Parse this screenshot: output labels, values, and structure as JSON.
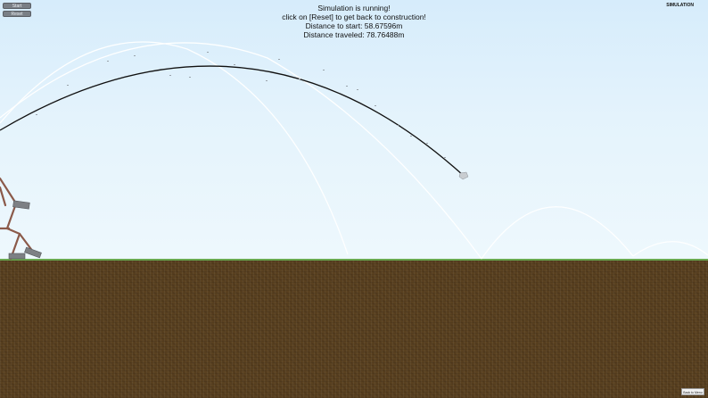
{
  "toolbar": {
    "start_label": "Start",
    "reset_label": "Reset"
  },
  "status": {
    "line1": "Simulation is running!",
    "line2": "click on [Reset] to get back to construction!",
    "line3": "Distance to start: 58.67596m",
    "line4": "Distance traveled: 78.76488m"
  },
  "mode_label": "SIMULATION",
  "bottom_button_label": "Back to Menu",
  "colors": {
    "sky_top": "#d6ecfb",
    "ground": "#5a4120",
    "projectile_path": "#111111",
    "bounce_trail": "#ffffff",
    "catapult_wood": "#8b5a4a"
  },
  "icons": {
    "projectile": "projectile-stone",
    "catapult": "catapult-structure"
  }
}
